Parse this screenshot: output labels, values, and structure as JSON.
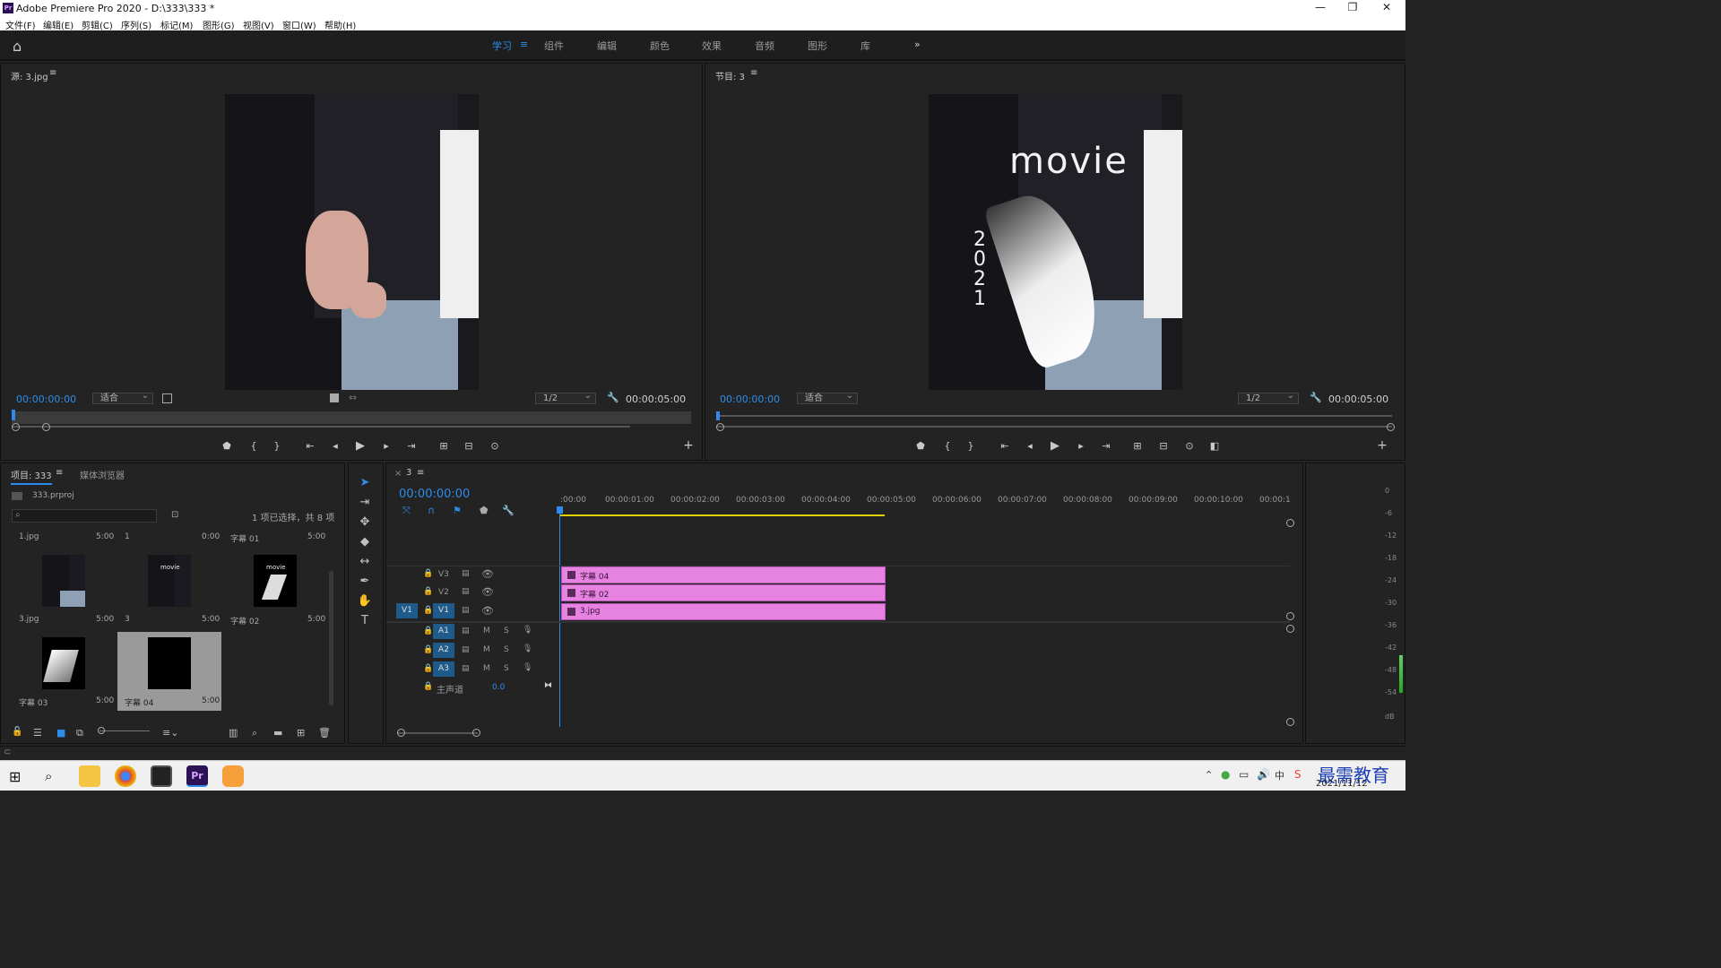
{
  "app": {
    "icon_label": "Pr",
    "title": "Adobe Premiere Pro 2020 - D:\\333\\333 *"
  },
  "window_controls": {
    "minimize": "—",
    "restore": "❐",
    "close": "✕"
  },
  "menu": [
    "文件(F)",
    "编辑(E)",
    "剪辑(C)",
    "序列(S)",
    "标记(M)",
    "图形(G)",
    "视图(V)",
    "窗口(W)",
    "帮助(H)"
  ],
  "workspaces": {
    "items": [
      "学习",
      "组件",
      "编辑",
      "颜色",
      "效果",
      "音频",
      "图形",
      "库"
    ],
    "active": "学习",
    "more": "»"
  },
  "source_monitor": {
    "title": "源: 3.jpg",
    "timecode": "00:00:00:00",
    "fit": "适合",
    "resolution": "1/2",
    "duration": "00:00:05:00"
  },
  "program_monitor": {
    "title": "节目: 3",
    "timecode": "00:00:00:00",
    "fit": "适合",
    "resolution": "1/2",
    "duration": "00:00:05:00",
    "overlay_title": "movie",
    "overlay_year": [
      "2",
      "0",
      "2",
      "1"
    ]
  },
  "project_panel": {
    "tab": "项目: 333",
    "tab2": "媒体浏览器",
    "file": "333.prproj",
    "selection_info": "1 项已选择，共 8 项",
    "items": [
      {
        "top_name": "1.jpg",
        "top_dur": "5:00",
        "name": "3.jpg",
        "dur": "5:00"
      },
      {
        "top_name": "1",
        "top_dur": "0:00",
        "name": "3",
        "dur": "5:00"
      },
      {
        "top_name": "字幕 01",
        "top_dur": "5:00",
        "name": "字幕 02",
        "dur": "5:00"
      },
      {
        "name": "字幕 03",
        "dur": "5:00"
      },
      {
        "name": "字幕 04",
        "dur": "5:00"
      }
    ],
    "thumb_text": "movie"
  },
  "timeline": {
    "tab": "3",
    "timecode": "00:00:00:00",
    "ruler": [
      ":00:00",
      "00:00:01:00",
      "00:00:02:00",
      "00:00:03:00",
      "00:00:04:00",
      "00:00:05:00",
      "00:00:06:00",
      "00:00:07:00",
      "00:00:08:00",
      "00:00:09:00",
      "00:00:10:00",
      "00:00:1"
    ],
    "video_tracks": [
      "V3",
      "V2",
      "V1"
    ],
    "audio_tracks": [
      "A1",
      "A2",
      "A3"
    ],
    "source_patch": "V1",
    "mute": "M",
    "solo": "S",
    "master_label": "主声道",
    "master_value": "0.0",
    "clips": [
      {
        "track": "V3",
        "name": "字幕 04"
      },
      {
        "track": "V2",
        "name": "字幕 02"
      },
      {
        "track": "V1",
        "name": "3.jpg"
      }
    ]
  },
  "audio_meter": {
    "labels": [
      "0",
      "-6",
      "-12",
      "-18",
      "-24",
      "-30",
      "-36",
      "-42",
      "-48",
      "-54",
      "dB"
    ]
  },
  "taskbar": {
    "date": "2021/11/12",
    "ime": "中",
    "watermark": "最需教育"
  },
  "colors": {
    "accent": "#2d8ceb",
    "clip": "#e683e0",
    "panel": "#232323"
  }
}
